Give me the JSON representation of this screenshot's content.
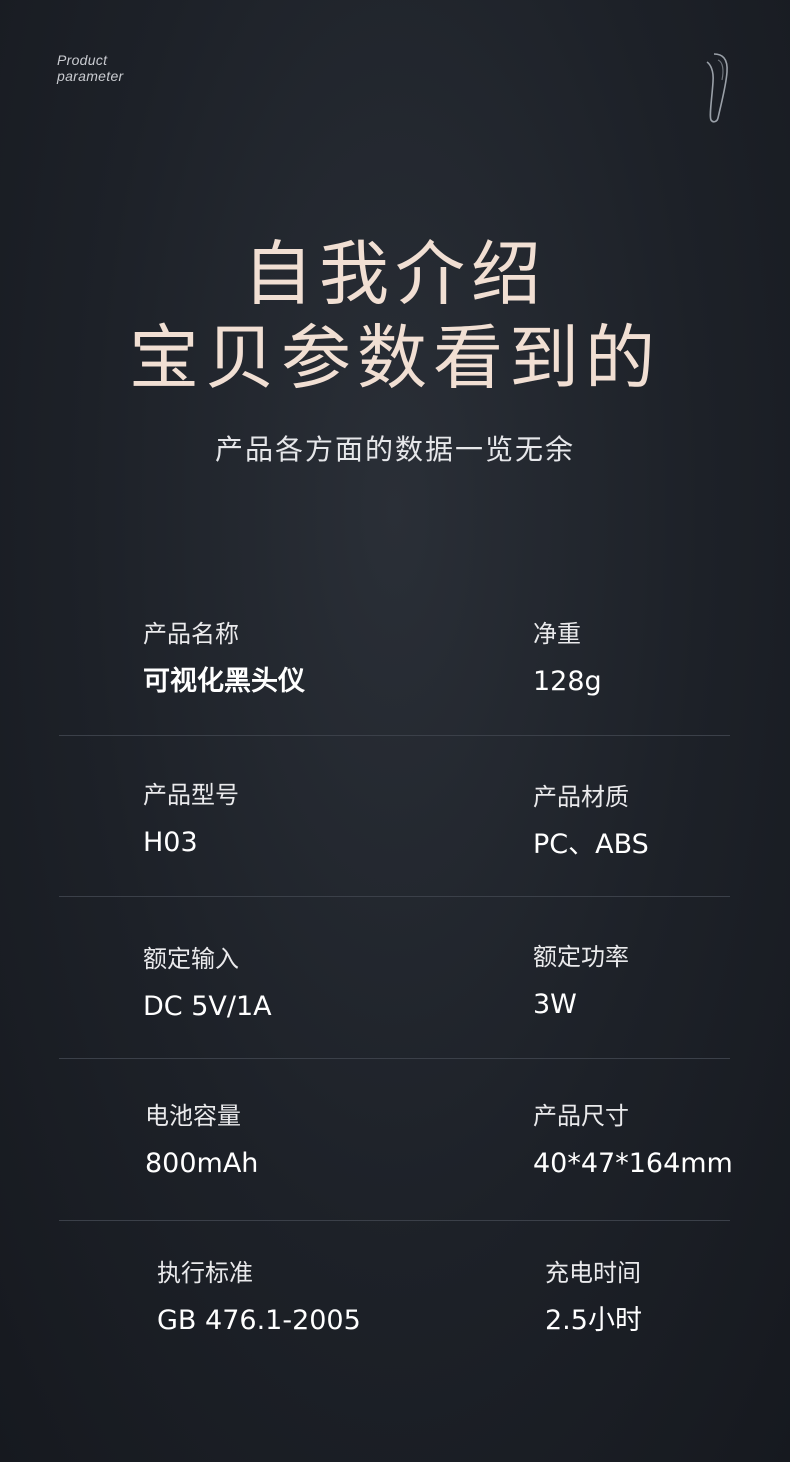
{
  "header": {
    "en_line1": "Product",
    "en_line2": "parameter",
    "icon": "earpiece-device-icon"
  },
  "title": {
    "line1": "自我介绍",
    "line2": "宝贝参数看到的"
  },
  "subtitle": "产品各方面的数据一览无余",
  "specs": [
    {
      "left": {
        "label": "产品名称",
        "value": "可视化黑头仪"
      },
      "right": {
        "label": "净重",
        "value": "128g"
      }
    },
    {
      "left": {
        "label": "产品型号",
        "value": "H03"
      },
      "right": {
        "label": "产品材质",
        "value": "PC、ABS"
      }
    },
    {
      "left": {
        "label": "额定输入",
        "value": "DC 5V/1A"
      },
      "right": {
        "label": "额定功率",
        "value": "3W"
      }
    },
    {
      "left": {
        "label": "电池容量",
        "value": "800mAh"
      },
      "right": {
        "label": "产品尺寸",
        "value": "40*47*164mm"
      }
    },
    {
      "left": {
        "label": "执行标准",
        "value": "GB 476.1-2005"
      },
      "right": {
        "label": "充电时间",
        "value": "2.5小时"
      }
    }
  ],
  "colors": {
    "background": "#1d2128",
    "title": "#f1dfd3",
    "divider": "#3b4049"
  }
}
